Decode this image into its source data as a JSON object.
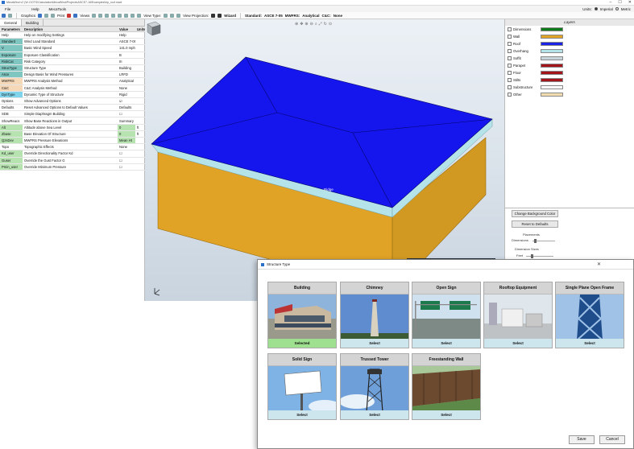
{
  "window": {
    "title": "MecaWind v2 (W..DOTS\\Calculation\\MecaWind\\Projects\\ASCE7-16\\Examples\\hip_roof.mwd",
    "controls": [
      "–",
      "☐",
      "✕"
    ]
  },
  "menu": {
    "items": [
      "File",
      "Help",
      "MecaTools"
    ],
    "units_label": "Units:",
    "units": [
      "Imperial",
      "Metric"
    ]
  },
  "toolbar": {
    "graphics_label": "Graphics",
    "print_label": "Print",
    "views_label": "Views",
    "view_type_label": "View Type:",
    "view_projection_label": "View Projection:",
    "wizard_label": "Wizard",
    "standard_label": "Standard:",
    "standard_value": "ASCE 7-05",
    "mwfrs_label": "MWFRS:",
    "mwfrs_value": "Analytical",
    "cc_label": "C&C:",
    "cc_value": "None"
  },
  "left_panel": {
    "tabs": [
      "General",
      "Building"
    ],
    "headers": [
      "Parameters",
      "Description",
      "Value",
      "Units"
    ],
    "rows": [
      {
        "param": "Help",
        "desc": "Help on modifying Settings",
        "value": "Help",
        "unit": "",
        "color": ""
      },
      {
        "param": "Standard",
        "desc": "Wind Load Standard",
        "value": "ASCE 7-05",
        "unit": "",
        "color": "#7fc6c0"
      },
      {
        "param": "V",
        "desc": "Basic Wind Speed",
        "value": "141.0 mph",
        "unit": "",
        "color": "#7fc6c0"
      },
      {
        "param": "Exposure",
        "desc": "Exposure Classification",
        "value": "B",
        "unit": "",
        "color": "#7fc6c0"
      },
      {
        "param": "RiskCat",
        "desc": "Risk Category",
        "value": "III",
        "unit": "",
        "color": "#7fc6c0"
      },
      {
        "param": "StrucType",
        "desc": "Structure Type",
        "value": "Building",
        "unit": "",
        "color": "#7fc6c0"
      },
      {
        "param": "Asce",
        "desc": "Design Basis for Wind Pressures",
        "value": "LRFD",
        "unit": "",
        "color": "#7fc6c0"
      },
      {
        "param": "MWFRS",
        "desc": "MWFRS Analysis Method",
        "value": "Analytical",
        "unit": "",
        "color": "#f5d8b8"
      },
      {
        "param": "C&C",
        "desc": "C&C Analysis Method",
        "value": "None",
        "unit": "",
        "color": "#f5d8b8"
      },
      {
        "param": "DynType",
        "desc": "Dynamic Type of Structure",
        "value": "Rigid",
        "unit": "",
        "color": "#7fd3ea"
      },
      {
        "param": "Options",
        "desc": "Show Advanced Options",
        "value": "☑",
        "unit": "",
        "color": ""
      },
      {
        "param": "Defaults",
        "desc": "Reset Advanced Options to Default Values",
        "value": "Defaults",
        "unit": "",
        "color": ""
      },
      {
        "param": "SDB",
        "desc": "Simple Diaphragm Building",
        "value": "☐",
        "unit": "",
        "color": ""
      },
      {
        "param": "ShowReacs",
        "desc": "Show Base Reactions in Output",
        "value": "Summary",
        "unit": "",
        "color": ""
      },
      {
        "param": "Alt",
        "desc": "Altitude above Sea Level",
        "value": "0",
        "unit": "ft",
        "color": "#b7e3b1"
      },
      {
        "param": "Zbase",
        "desc": "Base Elevation Of Structure",
        "value": "0",
        "unit": "ft",
        "color": "#b7e3b1"
      },
      {
        "param": "QzsDev",
        "desc": "MWFRS Pressure Elevations",
        "value": "Mean Ht",
        "unit": "",
        "color": "#b7e3b1"
      },
      {
        "param": "Topo",
        "desc": "Topographic Effects",
        "value": "None",
        "unit": "",
        "color": ""
      },
      {
        "param": "Kd_user",
        "desc": "Override Directionality Factor Kd",
        "value": "☐",
        "unit": "",
        "color": "#b7e3b1"
      },
      {
        "param": "Guser",
        "desc": "Override the Gust Factor G",
        "value": "☐",
        "unit": "",
        "color": "#b7e3b1"
      },
      {
        "param": "Pmin_user",
        "desc": "Override Minimum Pressure",
        "value": "☐",
        "unit": "",
        "color": "#b7e3b1"
      }
    ]
  },
  "viewport": {
    "ridge_label": "Ridge"
  },
  "layers": {
    "title": "Layers",
    "items": [
      {
        "name": "Dimensions",
        "color": "#0e7a1a",
        "checked": true
      },
      {
        "name": "Wall",
        "color": "#e0a325",
        "checked": true
      },
      {
        "name": "Roof",
        "color": "#1a22e6",
        "checked": true
      },
      {
        "name": "Overhang",
        "color": "#b5e3ea",
        "checked": true
      },
      {
        "name": "Soffit",
        "color": "#c8d5da",
        "checked": true
      },
      {
        "name": "Parapet",
        "color": "#a3151b",
        "checked": true
      },
      {
        "name": "Floor",
        "color": "#a3151b",
        "checked": true
      },
      {
        "name": "Stilts",
        "color": "#a3151b",
        "checked": true
      },
      {
        "name": "Substructure",
        "color": "#ffffff",
        "checked": true
      },
      {
        "name": "Other",
        "color": "#f2dcb0",
        "checked": true
      }
    ],
    "change_bg_label": "Change Background Color",
    "reset_label": "Reset to Defaults",
    "placements_label": "Placements",
    "dimensions_label": "Dimensions",
    "dimension_sizes_label": "Dimension Sizes",
    "feet_label": "Feet"
  },
  "dialog": {
    "title": "Structure Type",
    "cards": [
      {
        "label": "Building",
        "button": "Selected",
        "selected": true
      },
      {
        "label": "Chimney",
        "button": "Select",
        "selected": false
      },
      {
        "label": "Open Sign",
        "button": "Select",
        "selected": false
      },
      {
        "label": "Rooftop Equipment",
        "button": "Select",
        "selected": false
      },
      {
        "label": "Single Plane Open Frame",
        "button": "Select",
        "selected": false
      },
      {
        "label": "Solid Sign",
        "button": "Select",
        "selected": false
      },
      {
        "label": "Trussed Tower",
        "button": "Select",
        "selected": false
      },
      {
        "label": "Freestanding Wall",
        "button": "Select",
        "selected": false
      }
    ],
    "save_label": "Save",
    "cancel_label": "Cancel"
  }
}
